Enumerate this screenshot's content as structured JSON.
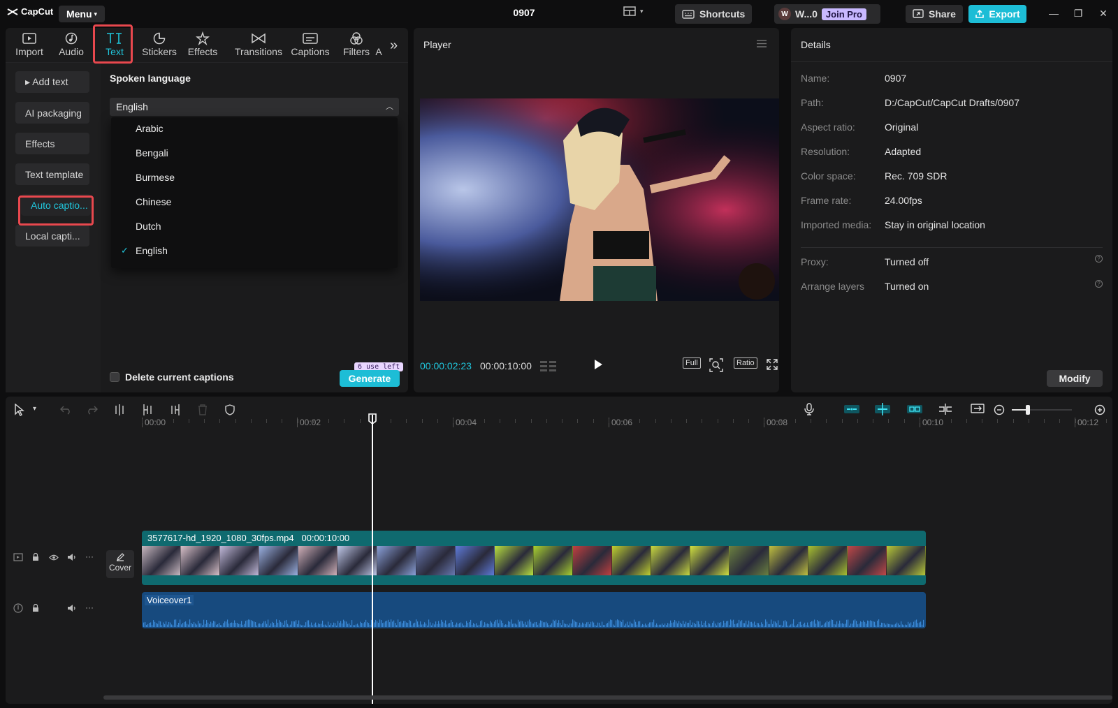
{
  "titlebar": {
    "brand": "CapCut",
    "menu_label": "Menu",
    "project_title": "0907",
    "shortcuts_label": "Shortcuts",
    "user_initial": "W",
    "user_name": "W...0",
    "join_pro_label": "Join Pro",
    "share_label": "Share",
    "export_label": "Export"
  },
  "tool_tabs": [
    {
      "label": "Import",
      "icon": "import-icon"
    },
    {
      "label": "Audio",
      "icon": "audio-icon"
    },
    {
      "label": "Text",
      "icon": "text-icon",
      "active": true
    },
    {
      "label": "Stickers",
      "icon": "sticker-icon"
    },
    {
      "label": "Effects",
      "icon": "effects-icon"
    },
    {
      "label": "Transitions",
      "icon": "transitions-icon"
    },
    {
      "label": "Captions",
      "icon": "captions-icon"
    },
    {
      "label": "Filters",
      "icon": "filters-icon"
    },
    {
      "label": "A",
      "icon": ""
    }
  ],
  "text_categories": [
    {
      "label": "▸ Add text"
    },
    {
      "label": "AI packaging"
    },
    {
      "label": "Effects"
    },
    {
      "label": "Text template"
    },
    {
      "label": "Auto captio...",
      "active": true
    },
    {
      "label": "Local capti..."
    }
  ],
  "spoken_language": {
    "label": "Spoken language",
    "selected": "English",
    "options": [
      "Arabic",
      "Bengali",
      "Burmese",
      "Chinese",
      "Dutch",
      "English"
    ],
    "checked_index": 5
  },
  "captions_footer": {
    "delete_label": "Delete current captions",
    "uses_left": "6 use left",
    "generate_label": "Generate"
  },
  "player": {
    "title": "Player",
    "current_time": "00:00:02:23",
    "total_time": "00:00:10:00",
    "full_label": "Full",
    "ratio_label": "Ratio"
  },
  "details": {
    "title": "Details",
    "rows": [
      {
        "key": "Name:",
        "value": "0907"
      },
      {
        "key": "Path:",
        "value": "D:/CapCut/CapCut Drafts/0907"
      },
      {
        "key": "Aspect ratio:",
        "value": "Original"
      },
      {
        "key": "Resolution:",
        "value": "Adapted"
      },
      {
        "key": "Color space:",
        "value": "Rec. 709 SDR"
      },
      {
        "key": "Frame rate:",
        "value": "24.00fps"
      },
      {
        "key": "Imported media:",
        "value": "Stay in original location"
      }
    ],
    "extra_rows": [
      {
        "key": "Proxy:",
        "value": "Turned off"
      },
      {
        "key": "Arrange layers",
        "value": "Turned on"
      }
    ],
    "modify_label": "Modify"
  },
  "timeline": {
    "ruler": [
      "00:00",
      "00:02",
      "00:04",
      "00:06",
      "00:08",
      "00:10",
      "00:12"
    ],
    "video_clip": {
      "name": "3577617-hd_1920_1080_30fps.mp4",
      "duration": "00:00:10:00"
    },
    "cover_label": "Cover",
    "audio_clip": {
      "name": "Voiceover1"
    },
    "playhead_time": "00:00:02:23"
  },
  "colors": {
    "accent": "#1dbdd6",
    "highlight": "#e8484e",
    "video_track": "#0f6a6f",
    "audio_track": "#174a7e"
  }
}
